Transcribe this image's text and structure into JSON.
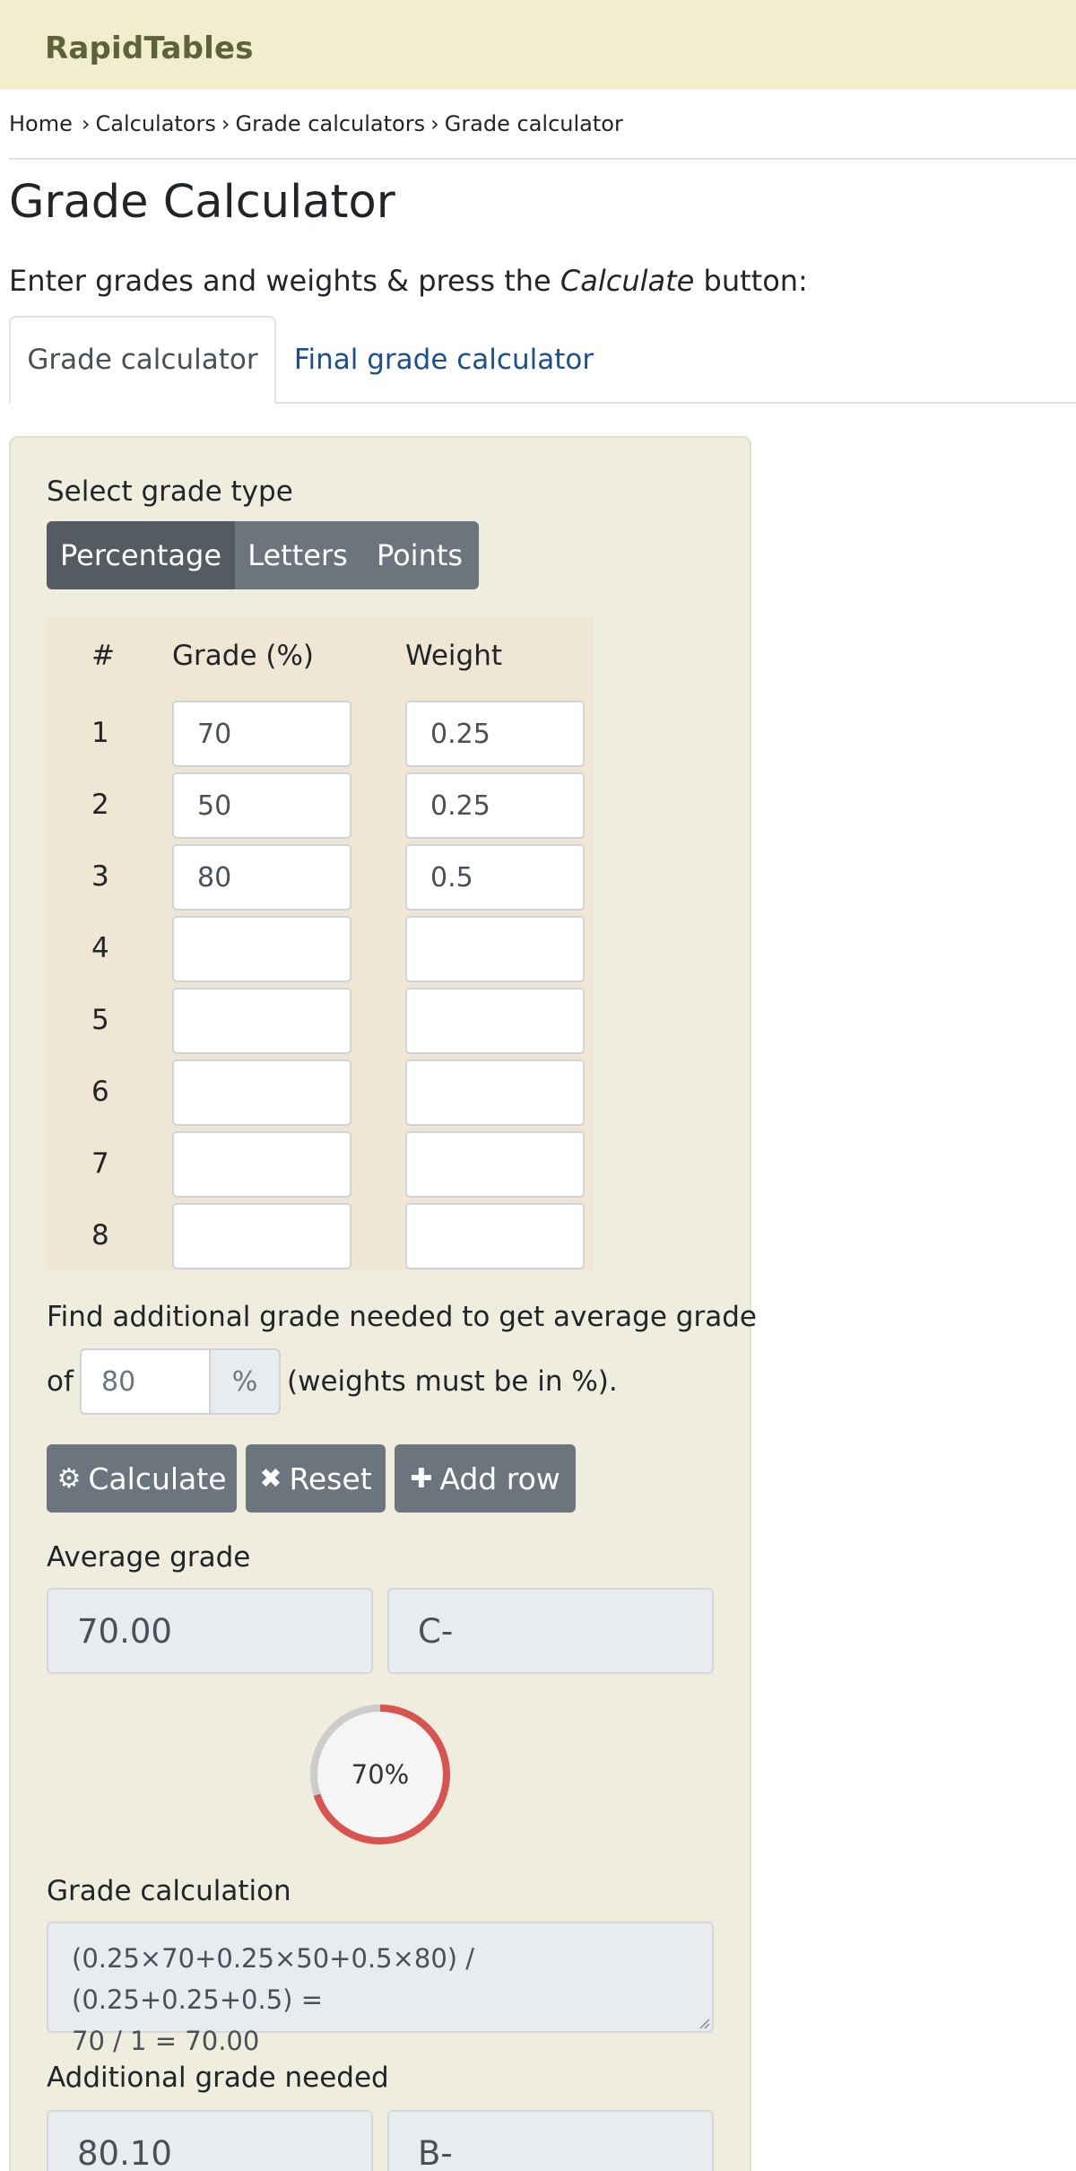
{
  "header": {
    "brand": "RapidTables"
  },
  "breadcrumb": [
    "Home",
    "Calculators",
    "Grade calculators",
    "Grade calculator"
  ],
  "breadcrumb_separator": "›",
  "page": {
    "title": "Grade Calculator",
    "intro_before": "Enter grades and weights & press the ",
    "intro_em": "Calculate",
    "intro_after": " button:"
  },
  "tabs": [
    {
      "label": "Grade calculator",
      "active": true
    },
    {
      "label": "Final grade calculator",
      "active": false
    }
  ],
  "grade_type": {
    "label": "Select grade type",
    "options": [
      "Percentage",
      "Letters",
      "Points"
    ],
    "selected": "Percentage"
  },
  "table": {
    "headers": {
      "num": "#",
      "grade": "Grade (%)",
      "weight": "Weight"
    },
    "rows": [
      {
        "num": "1",
        "grade": "70",
        "weight": "0.25"
      },
      {
        "num": "2",
        "grade": "50",
        "weight": "0.25"
      },
      {
        "num": "3",
        "grade": "80",
        "weight": "0.5"
      },
      {
        "num": "4",
        "grade": "",
        "weight": ""
      },
      {
        "num": "5",
        "grade": "",
        "weight": ""
      },
      {
        "num": "6",
        "grade": "",
        "weight": ""
      },
      {
        "num": "7",
        "grade": "",
        "weight": ""
      },
      {
        "num": "8",
        "grade": "",
        "weight": ""
      }
    ]
  },
  "additional": {
    "line1": "Find additional grade needed to get average grade",
    "of": "of",
    "target_placeholder": "80",
    "addon": "%",
    "note": "(weights must be in %)."
  },
  "buttons": {
    "calculate": {
      "label": "Calculate",
      "icon": "gear-icon"
    },
    "reset": {
      "label": "Reset",
      "icon": "close-icon"
    },
    "add_row": {
      "label": "Add row",
      "icon": "plus-icon"
    }
  },
  "results": {
    "average_label": "Average grade",
    "average_value": "70.00",
    "average_letter": "C-",
    "donut_percent": 70,
    "donut_label": "70%",
    "calc_label": "Grade calculation",
    "calc_line1": "(0.25×70+0.25×50+0.5×80) / (0.25+0.25+0.5) =",
    "calc_line2": "70 / 1 = 70.00",
    "needed_label": "Additional grade needed",
    "needed_value": "80.10",
    "needed_letter": "B-"
  },
  "colors": {
    "topbar": "#f0eecc",
    "panel": "#efeddd",
    "button": "#6c757d",
    "button_active": "#545b62",
    "link": "#1a4e95",
    "donut_fill": "#d9534f",
    "donut_track": "#cccccc"
  }
}
